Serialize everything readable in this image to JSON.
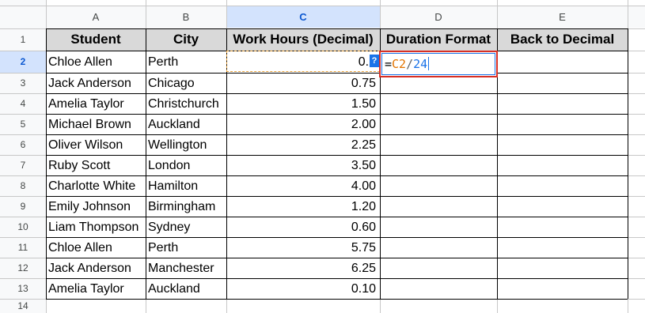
{
  "columns": [
    {
      "letter": "A",
      "selected": false
    },
    {
      "letter": "B",
      "selected": false
    },
    {
      "letter": "C",
      "selected": true
    },
    {
      "letter": "D",
      "selected": false
    },
    {
      "letter": "E",
      "selected": false
    }
  ],
  "row_numbers": [
    "1",
    "2",
    "3",
    "4",
    "5",
    "6",
    "7",
    "8",
    "9",
    "10",
    "11",
    "12",
    "13",
    "14"
  ],
  "selected_row": "2",
  "headers": [
    "Student",
    "City",
    "Work Hours (Decimal)",
    "Duration Format",
    "Back to Decimal"
  ],
  "rows": [
    {
      "student": "Chloe Allen",
      "city": "Perth",
      "hours": "0.2"
    },
    {
      "student": "Jack Anderson",
      "city": "Chicago",
      "hours": "0.75"
    },
    {
      "student": "Amelia Taylor",
      "city": "Christchurch",
      "hours": "1.50"
    },
    {
      "student": "Michael Brown",
      "city": "Auckland",
      "hours": "2.00"
    },
    {
      "student": "Oliver Wilson",
      "city": "Wellington",
      "hours": "2.25"
    },
    {
      "student": "Ruby Scott",
      "city": "London",
      "hours": "3.50"
    },
    {
      "student": "Charlotte White",
      "city": "Hamilton",
      "hours": "4.00"
    },
    {
      "student": "Emily Johnson",
      "city": "Birmingham",
      "hours": "1.20"
    },
    {
      "student": "Liam Thompson",
      "city": "Sydney",
      "hours": "0.60"
    },
    {
      "student": "Chloe Allen",
      "city": "Perth",
      "hours": "5.75"
    },
    {
      "student": "Jack Anderson",
      "city": "Manchester",
      "hours": "6.25"
    },
    {
      "student": "Amelia Taylor",
      "city": "Auckland",
      "hours": "0.10"
    }
  ],
  "editing": {
    "cell": "D2",
    "formula_eq": "=",
    "formula_ref": "C2",
    "formula_op": "/",
    "formula_num": "24",
    "help_badge": "?"
  },
  "colors": {
    "header_fill": "#d9d9d9",
    "selection_blue": "#d3e3fd",
    "edit_border": "#d93025",
    "reference_orange": "#e37400",
    "formula_blue": "#1a73e8"
  }
}
